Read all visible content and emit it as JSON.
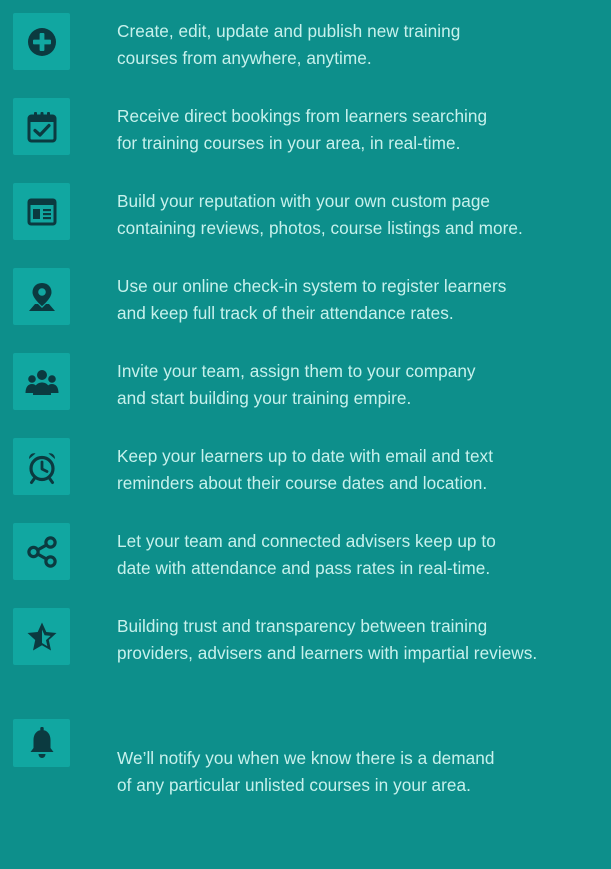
{
  "features": [
    {
      "icon": "plus-circle-icon",
      "line1": "Create, edit, update and publish new training",
      "line2": "courses from anywhere, anytime."
    },
    {
      "icon": "calendar-check-icon",
      "line1": "Receive direct bookings from learners searching",
      "line2": "for training courses in your area, in real-time."
    },
    {
      "icon": "web-page-icon",
      "line1": "Build your reputation with your own custom page",
      "line2": "containing reviews, photos, course listings and more."
    },
    {
      "icon": "map-pin-icon",
      "line1": "Use our online check-in system to register learners",
      "line2": "and keep full track of their attendance rates."
    },
    {
      "icon": "team-people-icon",
      "line1": "Invite your team, assign them to your company",
      "line2": "and start building your training empire."
    },
    {
      "icon": "alarm-clock-icon",
      "line1": "Keep your learners up to date with email and text",
      "line2": "reminders about their course dates and location."
    },
    {
      "icon": "share-icon",
      "line1": "Let your team and connected advisers keep up to",
      "line2": "date with attendance and pass rates in real-time."
    },
    {
      "icon": "half-star-icon",
      "line1": "Building trust and transparency between training",
      "line2": "providers, advisers and learners with impartial reviews."
    },
    {
      "icon": "bell-icon",
      "line1": "We’ll notify you when we know there is a demand",
      "line2": "of any particular unlisted courses in your area."
    }
  ],
  "colors": {
    "background": "#0d8f8b",
    "icon_tile": "#11a7a1",
    "icon_glyph": "#0b3a40",
    "text": "#c7f1ec"
  }
}
